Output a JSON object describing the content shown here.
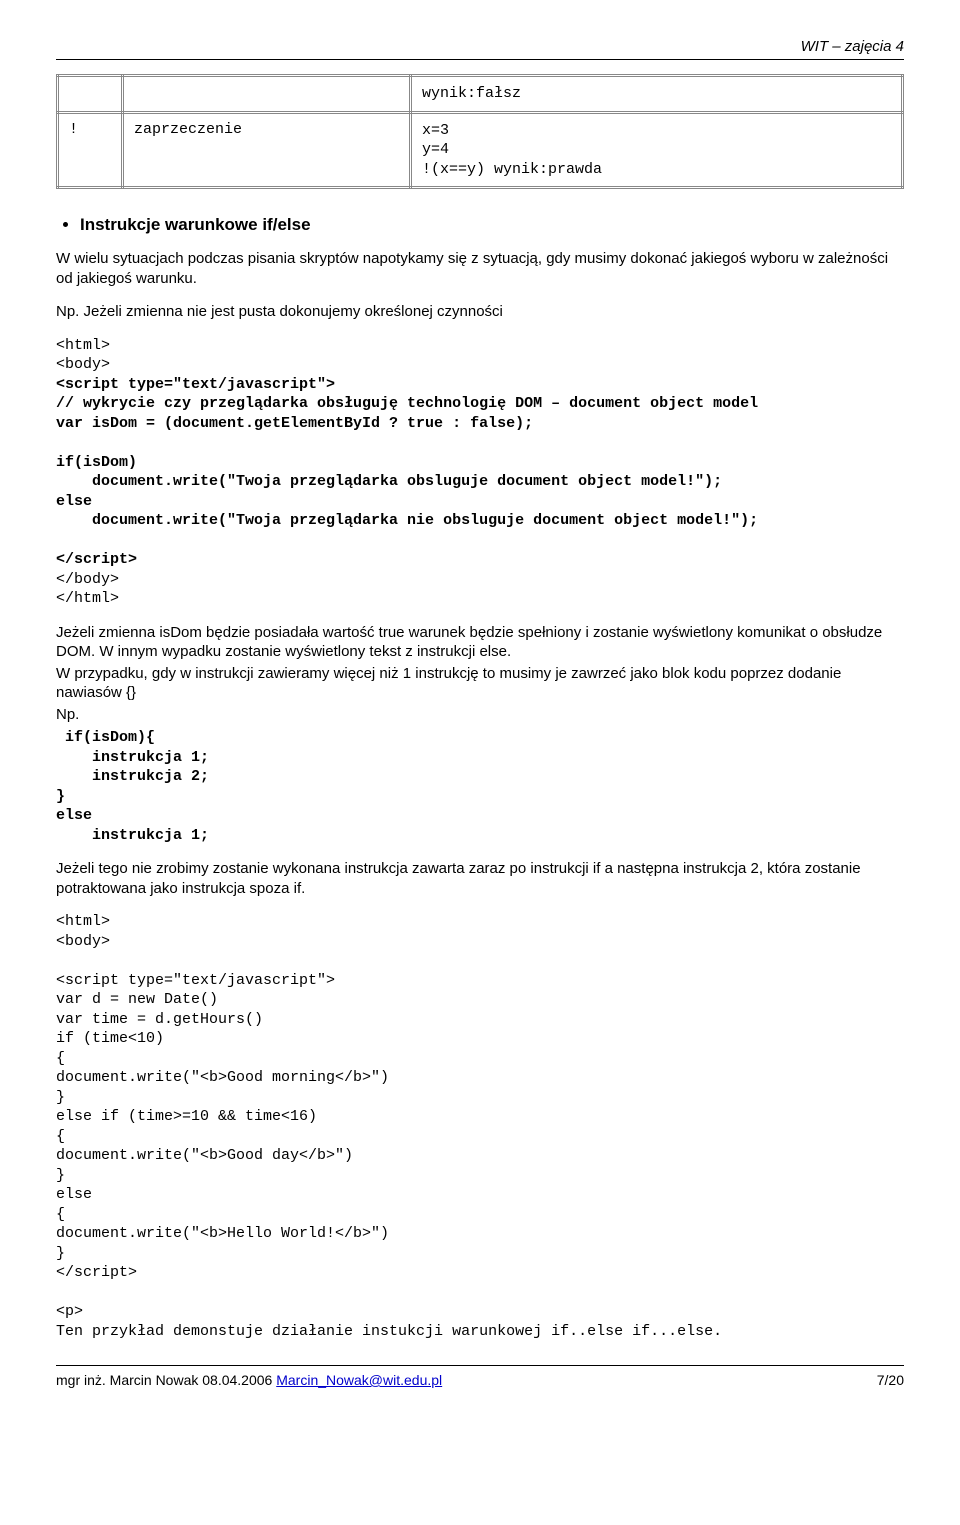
{
  "header": {
    "course": "WIT – zajęcia 4"
  },
  "table": {
    "row1": {
      "c1": "",
      "c2": "",
      "c3": "wynik:fałsz"
    },
    "row2": {
      "c1": "!",
      "c2": "zaprzeczenie",
      "c3": "x=3\ny=4\n!(x==y) wynik:prawda"
    }
  },
  "section1": {
    "bullet": "Instrukcje warunkowe if/else",
    "p1": "W wielu sytuacjach podczas pisania skryptów napotykamy się z sytuacją, gdy musimy dokonać jakiegoś wyboru w zależności od jakiegoś warunku.",
    "p2": "Np. Jeżeli zmienna nie jest pusta dokonujemy określonej czynności",
    "code1_pre": "<html>\n<body>",
    "code1_bold": "<script type=\"text/javascript\">\n// wykrycie czy przeglądarka obsługuję technologię DOM – document object model\nvar isDom = (document.getElementById ? true : false);\n\nif(isDom)\n    document.write(\"Twoja przeglądarka obsluguje document object model!\");\nelse\n    document.write(\"Twoja przeglądarka nie obsluguje document object model!\");\n\n</script>",
    "code1_post": "</body>\n</html>",
    "p3": "Jeżeli zmienna isDom będzie posiadała wartość true warunek będzie spełniony i zostanie wyświetlony komunikat o obsłudze DOM. W innym wypadku zostanie wyświetlony tekst z instrukcji else.",
    "p4": "W przypadku, gdy w instrukcji zawieramy więcej niż 1 instrukcję to musimy je zawrzeć jako blok kodu poprzez dodanie nawiasów {}",
    "np": "Np.",
    "code2": " if(isDom){\n    instrukcja 1;\n    instrukcja 2;\n}\nelse\n    instrukcja 1;",
    "p5": "Jeżeli tego nie zrobimy zostanie wykonana instrukcja zawarta zaraz po instrukcji if a następna instrukcja 2, która zostanie potraktowana jako instrukcja spoza if.",
    "code3": "<html>\n<body>\n\n<script type=\"text/javascript\">\nvar d = new Date()\nvar time = d.getHours()\nif (time<10)\n{\ndocument.write(\"<b>Good morning</b>\")\n}\nelse if (time>=10 && time<16)\n{\ndocument.write(\"<b>Good day</b>\")\n}\nelse\n{\ndocument.write(\"<b>Hello World!</b>\")\n}\n</script>\n\n<p>\nTen przykład demonstuje działanie instukcji warunkowej if..else if...else."
  },
  "footer": {
    "author": "mgr inż. Marcin Nowak 08.04.2006 ",
    "email": "Marcin_Nowak@wit.edu.pl",
    "page": "7/20"
  }
}
